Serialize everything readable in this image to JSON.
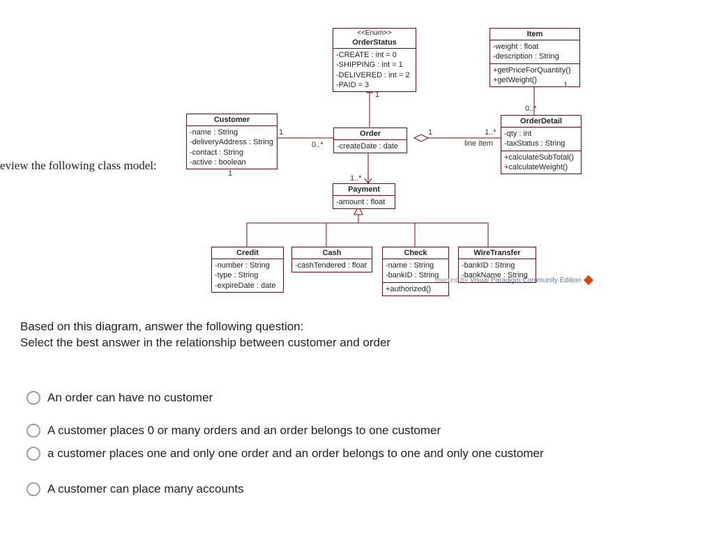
{
  "intro": "eview the following class model:",
  "question_prompt_line1": "Based on this diagram, answer the following question:",
  "question_prompt_line2": "Select the best answer in the relationship between customer and order",
  "classes": {
    "orderStatus": {
      "stereotype": "<<Enum>>",
      "name": "OrderStatus",
      "rows": [
        "-CREATE : int = 0",
        "-SHIPPING : int = 1",
        "-DELIVERED : int = 2",
        "-PAID = 3"
      ]
    },
    "item": {
      "name": "Item",
      "attrs": [
        "-weight : float",
        "-description : String"
      ],
      "ops": [
        "+getPriceForQuantity()",
        "+getWeight()"
      ]
    },
    "customer": {
      "name": "Customer",
      "attrs": [
        "-name : String",
        "-deliveryAddress : String",
        "-contact : String",
        "-active : boolean"
      ]
    },
    "order": {
      "name": "Order",
      "attrs": [
        "-createDate : date"
      ]
    },
    "orderDetail": {
      "name": "OrderDetail",
      "attrs": [
        "-qty : int",
        "-taxStatus : String"
      ],
      "ops": [
        "+calculateSubTotal()",
        "+calculateWeight()"
      ]
    },
    "payment": {
      "name": "Payment",
      "attrs": [
        "-amount : float"
      ]
    },
    "credit": {
      "name": "Credit",
      "attrs": [
        "-number : String",
        "-type : String",
        "-expireDate : date"
      ]
    },
    "cash": {
      "name": "Cash",
      "attrs": [
        "-cashTendered : float"
      ]
    },
    "check": {
      "name": "Check",
      "attrs": [
        "-name : String",
        "-bankID : String"
      ],
      "ops": [
        "+authorized()"
      ]
    },
    "wireTransfer": {
      "name": "WireTransfer",
      "attrs": [
        "-bankID : String",
        "-bankName : String"
      ]
    }
  },
  "labels": {
    "one_a": "1",
    "one_b": "1",
    "one_c": "1",
    "one_d": "1",
    "zero_star_a": "0..*",
    "zero_star_b": "0..*",
    "one_star_a": "1..*",
    "one_star_b": "1..*",
    "line_item": "line item"
  },
  "watermark_left": "owered By",
  "watermark_right": "Visual Paradigm Community Edition",
  "options": {
    "a": "An order can have no customer",
    "b": "A customer places 0 or many orders and an order belongs to one customer",
    "c": "a customer places one and only one order and an order belongs to one and only one customer",
    "d": "A customer can place many accounts"
  }
}
